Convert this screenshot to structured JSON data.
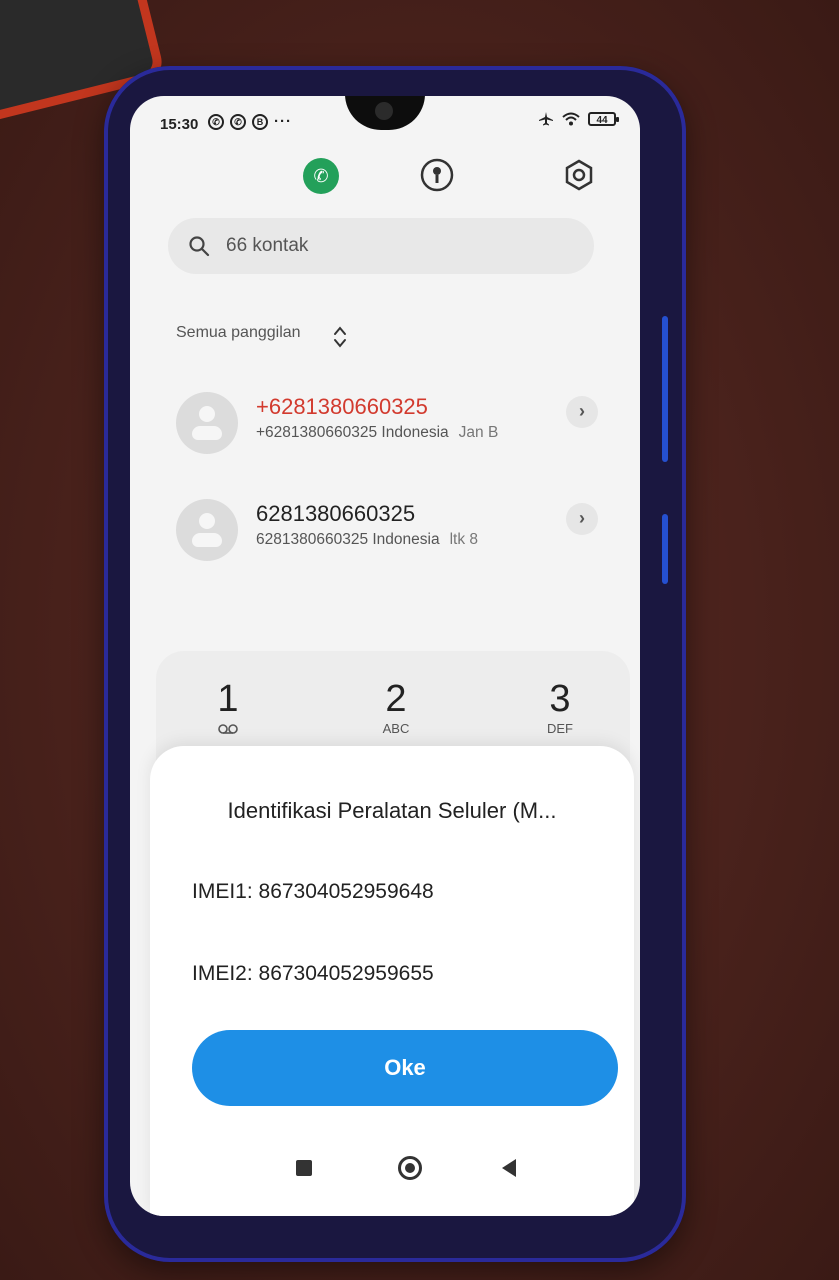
{
  "status_bar": {
    "time": "15:30",
    "left_icons": [
      "whatsapp-icon",
      "whatsapp-icon",
      "b-icon",
      "more-dots"
    ],
    "b_label": "B",
    "dots": "···",
    "right_icons": [
      "airplane-icon",
      "wifi-icon",
      "battery-icon"
    ],
    "battery": "44"
  },
  "top_nav": {
    "items": [
      "phone-icon",
      "contacts-icon",
      "settings-icon"
    ],
    "active_color": "#23a05a"
  },
  "search": {
    "placeholder": "66 kontak"
  },
  "filter": {
    "label": "Semua panggilan"
  },
  "calls": [
    {
      "name": "+6281380660325",
      "detail": "+6281380660325 Indonesia",
      "time": "Jan B",
      "missed": true,
      "color": "#d23a2e"
    },
    {
      "name": "6281380660325",
      "detail": "6281380660325 Indonesia",
      "time": "ltk   8",
      "missed": false
    }
  ],
  "dialpad": {
    "keys": [
      {
        "num": "1",
        "sub": "voicemail-icon"
      },
      {
        "num": "2",
        "sub": "ABC"
      },
      {
        "num": "3",
        "sub": "DEF"
      }
    ]
  },
  "dialog": {
    "title": "Identifikasi Peralatan Seluler (M...",
    "imei1": "IMEI1: 867304052959648",
    "imei2": "IMEI2: 867304052959655",
    "ok_label": "Oke",
    "button_color": "#1e8fe6"
  },
  "nav_bar": {
    "items": [
      "recents-icon",
      "home-icon",
      "back-icon"
    ]
  }
}
